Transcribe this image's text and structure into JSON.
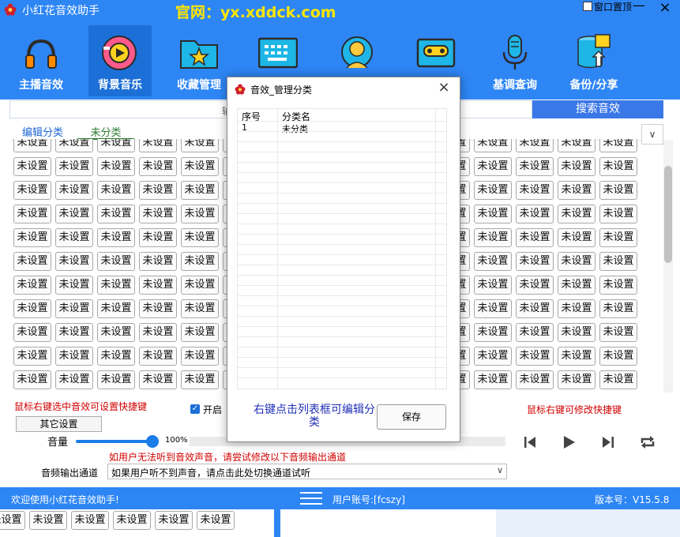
{
  "app": {
    "title": "小红花音效助手",
    "website": "官网：yx.xddck.com",
    "pin_label": "窗口置顶",
    "minimize_glyph": "—",
    "close_glyph": "×",
    "colors": {
      "primary": "#2e86f5",
      "active": "#1c6fd6",
      "url": "#ffe600",
      "warning": "#d00000"
    }
  },
  "nav": [
    {
      "label": "主播音效",
      "icon": "headphones-icon"
    },
    {
      "label": "背景音乐",
      "icon": "music-disc-icon",
      "active": true
    },
    {
      "label": "收藏管理",
      "icon": "star-folder-icon"
    },
    {
      "label": "",
      "icon": "keyboard-icon"
    },
    {
      "label": "",
      "icon": "avatar-icon"
    },
    {
      "label": "",
      "icon": "cassette-icon"
    },
    {
      "label": "基调查询",
      "icon": "microphone-icon"
    },
    {
      "label": "备份/分享",
      "icon": "database-upload-icon"
    }
  ],
  "search": {
    "partial_text": "输",
    "button_label": "搜索音效"
  },
  "tabs": [
    {
      "label": "编辑分类"
    },
    {
      "label": "未分类",
      "active": true
    }
  ],
  "dropdown_glyph": "∨",
  "sound_button_label": "未设置",
  "hints": {
    "left": "鼠标右键选中音效可设置快捷键",
    "enable_label": "开启",
    "right": "鼠标右键可修改快捷键",
    "warning": "如用户无法听到音效声音，请尝试修改以下音频输出通道"
  },
  "controls": {
    "other_settings": "其它设置",
    "volume_label": "音量",
    "volume_percent": 100,
    "volume_text": "100%",
    "output_label": "音频输出通道",
    "output_value": "如果用户听不到声音，请点击此处切换通道试听"
  },
  "status": {
    "welcome": "欢迎使用小红花音效助手!",
    "account": "用户账号:[fcszy]",
    "version": "版本号：V15.5.8"
  },
  "dialog": {
    "title": "音效_管理分类",
    "close_glyph": "×",
    "columns": [
      "序号",
      "分类名"
    ],
    "rows": [
      {
        "no": "1",
        "name": "未分类"
      }
    ],
    "hint": "右键点击列表框可编辑分类",
    "save_label": "保存"
  }
}
